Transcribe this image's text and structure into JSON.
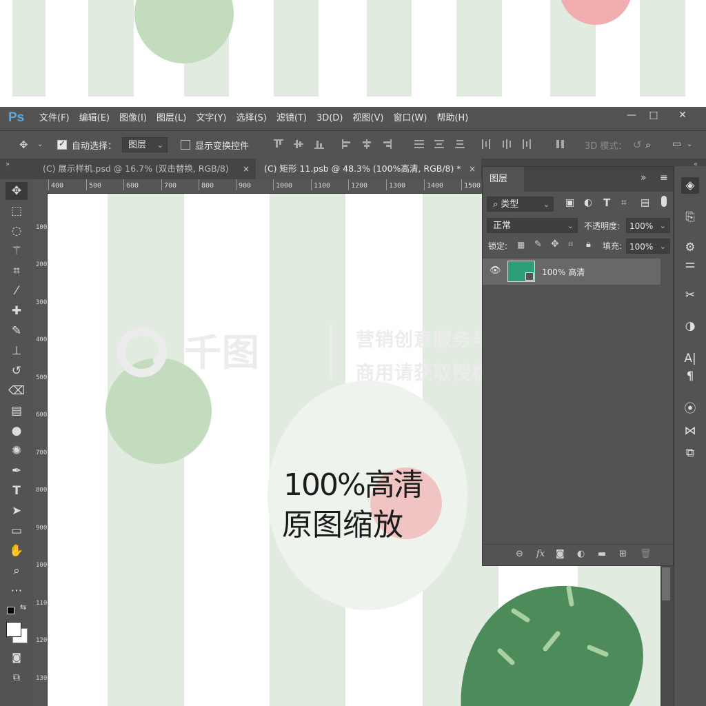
{
  "app": {
    "logo": "Ps"
  },
  "menu": [
    "文件(F)",
    "编辑(E)",
    "图像(I)",
    "图层(L)",
    "文字(Y)",
    "选择(S)",
    "滤镜(T)",
    "3D(D)",
    "视图(V)",
    "窗口(W)",
    "帮助(H)"
  ],
  "window_controls": {
    "minimize": "—",
    "restore": "□",
    "close": "✕"
  },
  "options_bar": {
    "auto_select_label": "自动选择：",
    "auto_select_checked": true,
    "auto_select_target": "图层",
    "show_transform_label": "显示变换控件",
    "show_transform_checked": false,
    "mode_3d_label": "3D 模式："
  },
  "tabs": [
    {
      "label": "(C) 展示样机.psd @ 16.7% (双击替换, RGB/8)",
      "close": "×",
      "active": false
    },
    {
      "label": "(C) 矩形 11.psb @ 48.3% (100%高清, RGB/8) *",
      "close": "×",
      "active": true
    }
  ],
  "ruler": {
    "horizontal": [
      "400",
      "500",
      "600",
      "700",
      "800",
      "900",
      "1000",
      "1100",
      "1200",
      "1300",
      "1400",
      "1500"
    ],
    "vertical": [
      "100",
      "200",
      "300",
      "400",
      "500",
      "600",
      "700",
      "800",
      "900",
      "1000",
      "1100",
      "1200",
      "1300"
    ]
  },
  "canvas": {
    "main_text_line1": "100%高清",
    "main_text_line2": "原图缩放",
    "watermark_logo": "千图",
    "watermark_line1": "营销创意服务与协作平台",
    "watermark_line2": "商用请获取授权"
  },
  "layers_panel": {
    "title": "图层",
    "filter_kind": "类型",
    "blend_mode": "正常",
    "opacity_label": "不透明度:",
    "opacity_value": "100%",
    "lock_label": "锁定:",
    "fill_label": "填充:",
    "fill_value": "100%",
    "layers": [
      {
        "name": "100% 高清",
        "visible": true,
        "thumb_color": "#2e9e7a"
      }
    ]
  },
  "colors": {
    "stripe": "#e1ebdf",
    "green_circle": "#c3dcbe",
    "pink_circle": "#f1aeae",
    "dark_leaf": "#4e8b5b",
    "ps_blue": "#5aa9e6"
  }
}
